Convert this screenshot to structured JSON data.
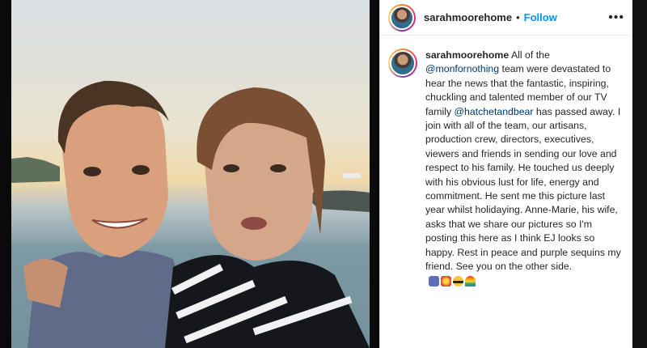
{
  "header": {
    "username": "sarahmoorehome",
    "separator": "•",
    "follow_label": "Follow",
    "more_icon": "more-options-icon",
    "more_glyph": "•••"
  },
  "caption": {
    "username": "sarahmoorehome",
    "text_1": "All of the",
    "mention_1": "@monfornothing",
    "text_2": "team were devastated to hear the news that the fantastic, inspiring, chuckling and talented member of our TV family",
    "mention_2": "@hatchetandbear",
    "text_3": "has passed away. I join with all of the team, our artisans, production crew, directors, executives, viewers and friends in sending our love and respect to his family. He touched us deeply with his obvious lust for life, energy and commitment. He sent me this picture last year whilst holidaying. Anne-Marie, his wife, asks that we share our pictures so I'm posting this here as I think EJ looks so happy. Rest in peace and purple sequins my friend. See you on the other side.",
    "emojis": [
      "ribbon-icon",
      "sparkle-icon",
      "sunglasses-icon",
      "rainbow-icon"
    ]
  },
  "colors": {
    "link": "#0095f6",
    "mention": "#00376b",
    "text": "#262626"
  }
}
